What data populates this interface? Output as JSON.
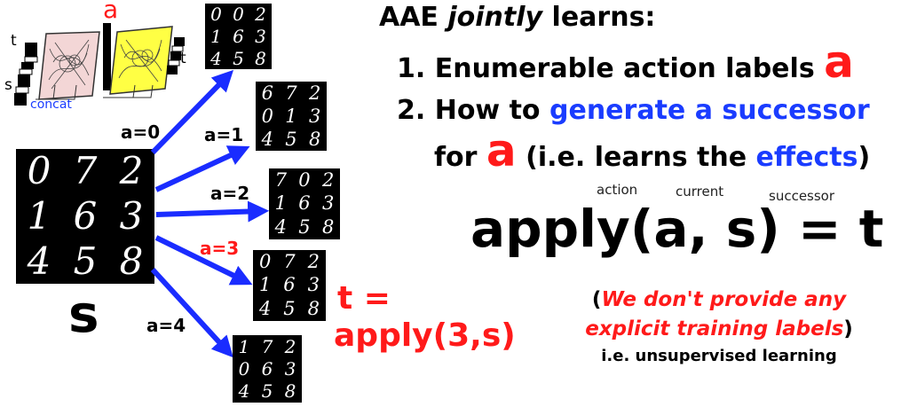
{
  "inset": {
    "label_a": "a",
    "label_t_left": "t",
    "label_t_right": "t",
    "label_s": "s",
    "label_concat": "concat"
  },
  "state": {
    "grid_digits": [
      "0",
      "7",
      "2",
      "1",
      "6",
      "3",
      "4",
      "5",
      "8"
    ],
    "label": "s"
  },
  "successors": [
    {
      "action": "a=0",
      "digits": [
        "0",
        "0",
        "2",
        "1",
        "6",
        "3",
        "4",
        "5",
        "8"
      ]
    },
    {
      "action": "a=1",
      "digits": [
        "6",
        "7",
        "2",
        "0",
        "1",
        "3",
        "4",
        "5",
        "8"
      ]
    },
    {
      "action": "a=2",
      "digits": [
        "7",
        "0",
        "2",
        "1",
        "6",
        "3",
        "4",
        "5",
        "8"
      ]
    },
    {
      "action": "a=3",
      "digits": [
        "0",
        "7",
        "2",
        "1",
        "6",
        "3",
        "4",
        "5",
        "8"
      ]
    },
    {
      "action": "a=4",
      "digits": [
        "1",
        "7",
        "2",
        "0",
        "6",
        "3",
        "4",
        "5",
        "8"
      ]
    }
  ],
  "result": {
    "line1": "t =",
    "line2": "apply(3,s)"
  },
  "text": {
    "title_pre": "AAE ",
    "title_em": "jointly",
    "title_post": " learns:",
    "item1": "1. Enumerable action labels",
    "item1_symbol": "a",
    "item2_pre": "2. How to ",
    "item2_blue": "generate a successor",
    "item2_for": "for",
    "item2_symbol": "a",
    "item2_paren_pre": "(i.e. learns the ",
    "item2_effects": "effects",
    "item2_paren_post": ")",
    "ann_action": "action",
    "ann_current": "current",
    "ann_successor": "successor",
    "formula": "apply(a, s) = t",
    "note_open": "(",
    "note_red_1": "We don't provide any",
    "note_red_2": "explicit training labels",
    "note_close": ")",
    "note_sub": "i.e. unsupervised learning"
  },
  "colors": {
    "red": "#ff1a1a",
    "blue": "#1a3cff",
    "pink": "#f3d6d6",
    "yellow": "#ffff44"
  }
}
